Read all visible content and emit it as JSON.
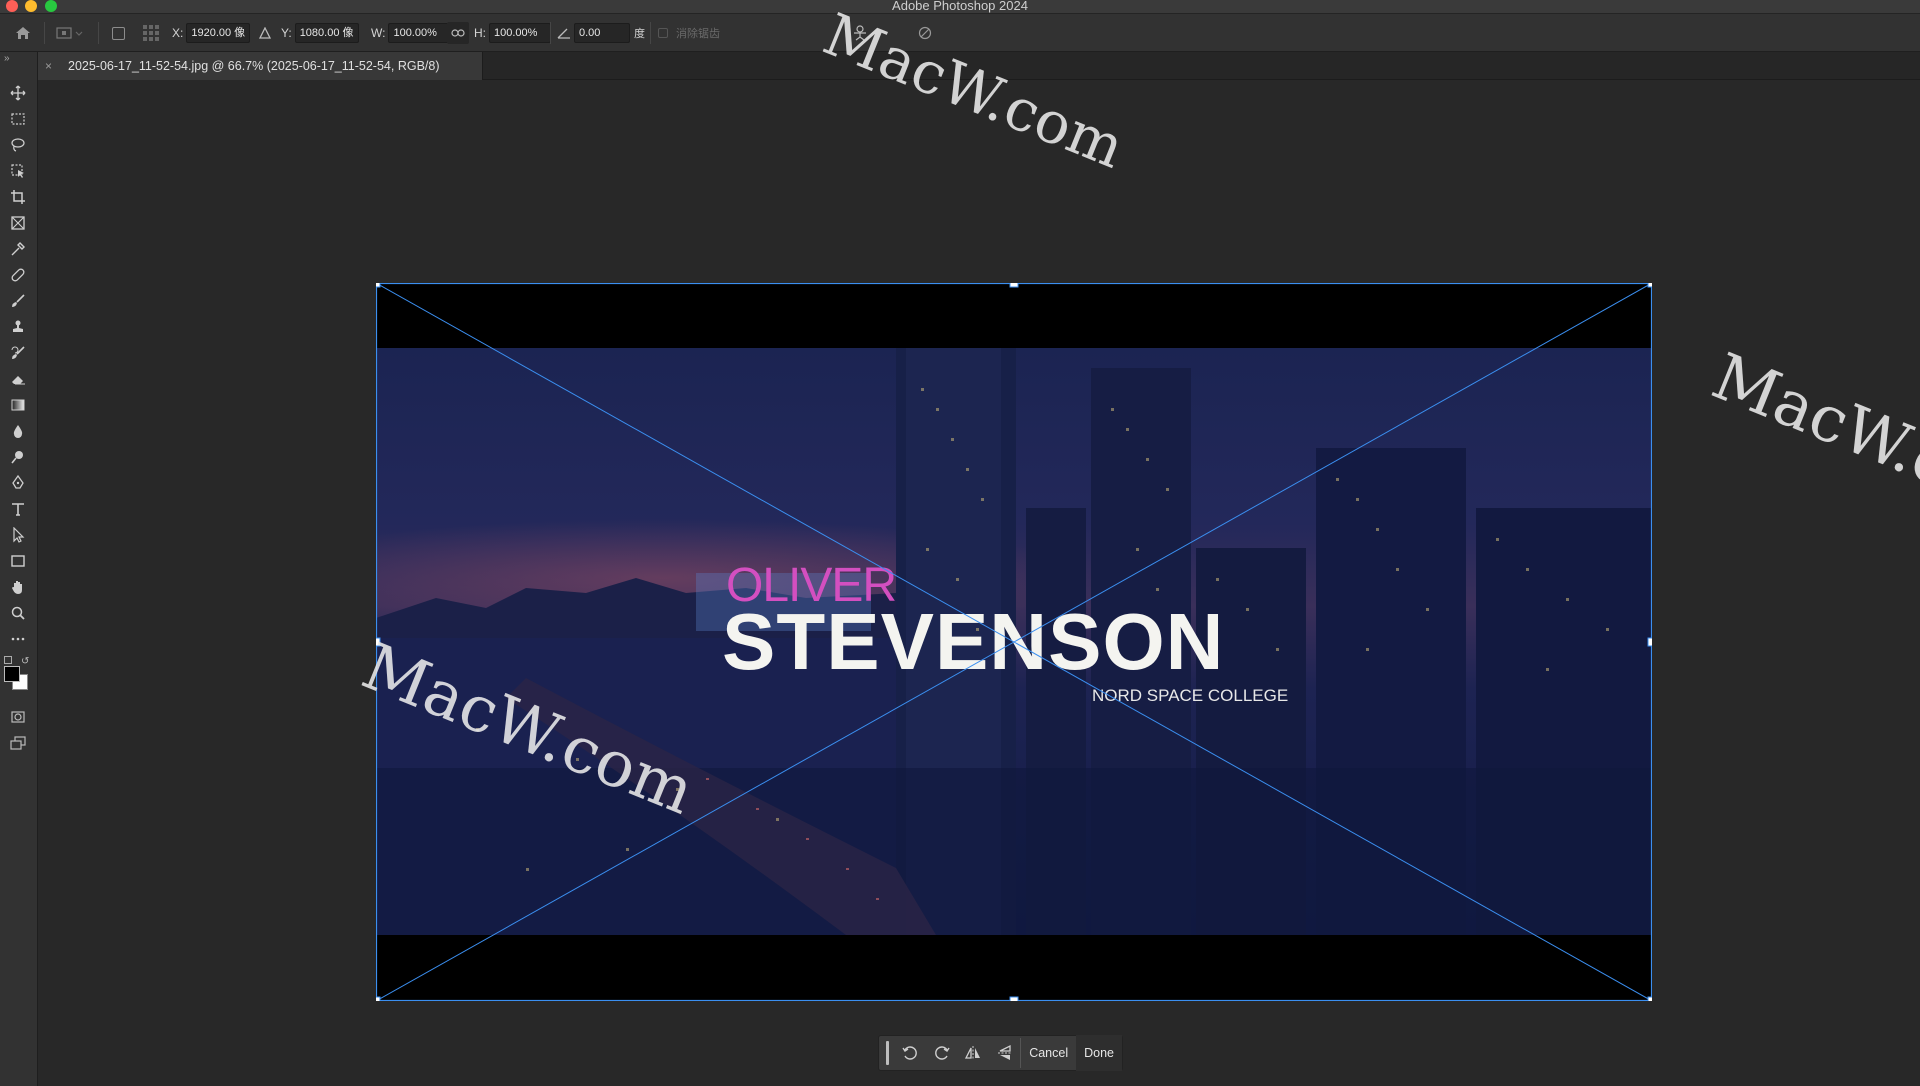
{
  "app": {
    "title": "Adobe Photoshop 2024"
  },
  "options_bar": {
    "x_label": "X:",
    "x_value": "1920.00 像",
    "y_label": "Y:",
    "y_value": "1080.00 像",
    "w_label": "W:",
    "w_value": "100.00%",
    "h_label": "H:",
    "h_value": "100.00%",
    "angle_value": "0.00",
    "angle_unit": "度",
    "antialias_label": "消除锯齿"
  },
  "document_tab": {
    "close_label": "×",
    "title": "2025-06-17_11-52-54.jpg @ 66.7% (2025-06-17_11-52-54, RGB/8)"
  },
  "toolbar": {
    "collapse_label": "»",
    "tools": [
      "move-tool",
      "marquee-tool",
      "lasso-tool",
      "object-select-tool",
      "crop-tool",
      "frame-tool",
      "eyedropper-tool",
      "healing-tool",
      "brush-tool",
      "stamp-tool",
      "history-brush-tool",
      "eraser-tool",
      "gradient-tool",
      "blur-tool",
      "dodge-tool",
      "pen-tool",
      "type-tool",
      "path-select-tool",
      "rectangle-tool",
      "hand-tool",
      "zoom-tool",
      "more-tools"
    ],
    "foreground_color": "#000000",
    "background_color": "#ffffff"
  },
  "canvas": {
    "text_oliver": "OLIVER",
    "text_stevenson": "STEVENSON",
    "text_college": "NORD SPACE COLLEGE"
  },
  "watermarks": [
    "MacW.com",
    "MacW.c",
    "MacW.com"
  ],
  "transform_bar": {
    "cancel_label": "Cancel",
    "done_label": "Done"
  },
  "colors": {
    "accent": "#3b8ff0",
    "oliver": "#d34fc0"
  }
}
